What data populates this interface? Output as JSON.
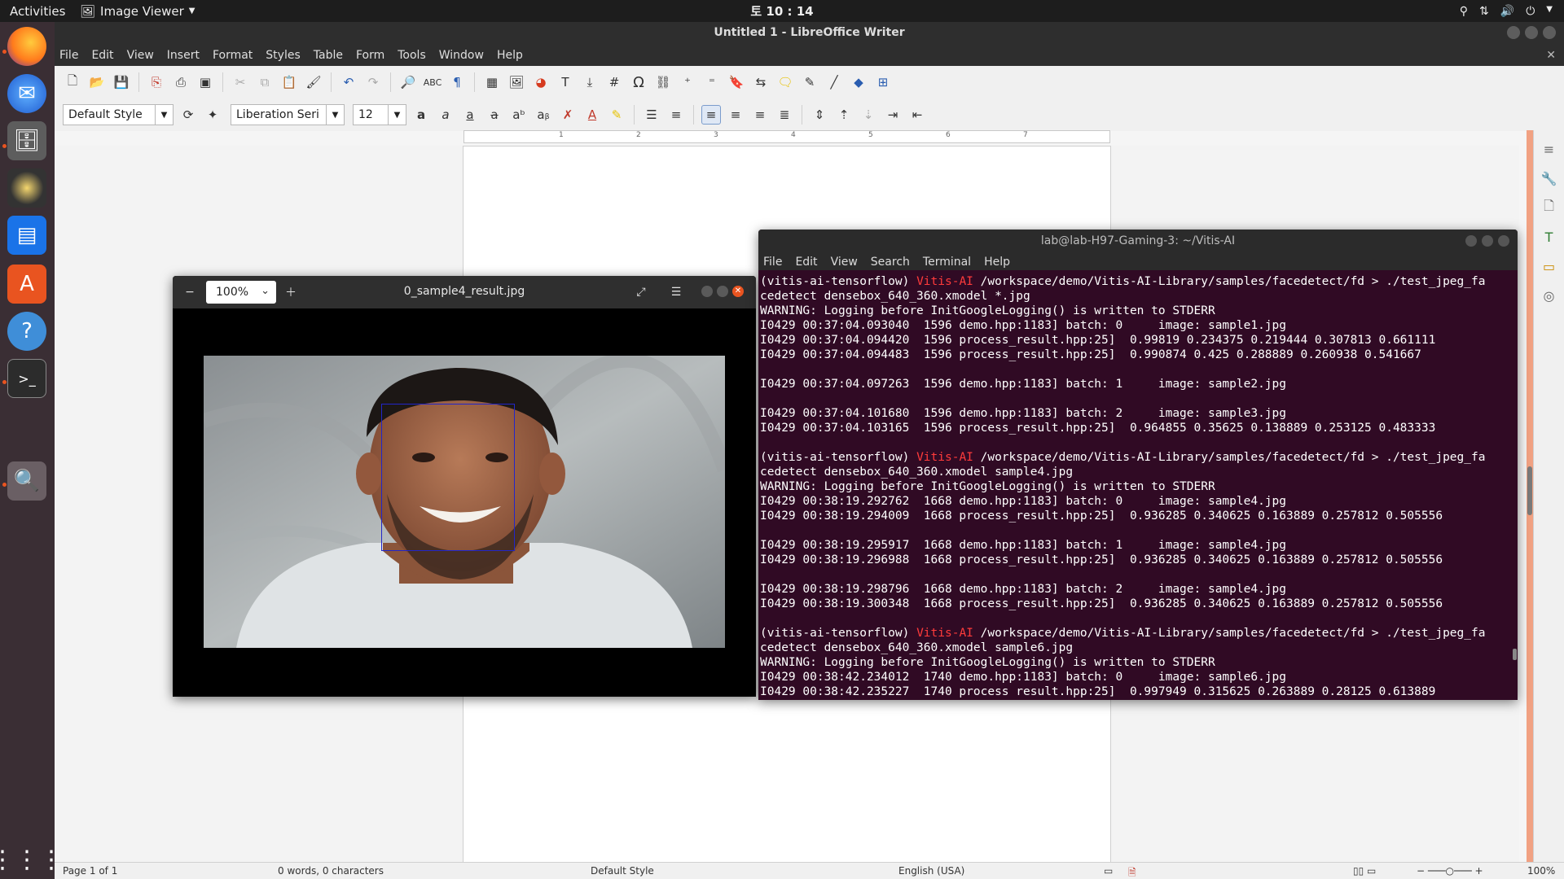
{
  "topbar": {
    "activities": "Activities",
    "app_menu": "Image Viewer",
    "clock": "토 10 : 14"
  },
  "dock": {
    "items": [
      "firefox-icon",
      "thunderbird-icon",
      "files-icon",
      "rhythmbox-icon",
      "writer-icon",
      "software-icon",
      "help-icon",
      "terminal-icon",
      "image-viewer-icon"
    ]
  },
  "writer": {
    "title": "Untitled 1 - LibreOffice Writer",
    "menu": [
      "File",
      "Edit",
      "View",
      "Insert",
      "Format",
      "Styles",
      "Table",
      "Form",
      "Tools",
      "Window",
      "Help"
    ],
    "paragraph_style": "Default Style",
    "font_name": "Liberation Seri",
    "font_size": "12",
    "ruler_numbers": [
      "1",
      "2",
      "3",
      "4",
      "5",
      "6",
      "7"
    ],
    "status": {
      "page": "Page 1 of 1",
      "words": "0 words, 0 characters",
      "style": "Default Style",
      "language": "English (USA)",
      "zoom": "100%"
    }
  },
  "viewer": {
    "filename": "0_sample4_result.jpg",
    "zoom": "100%"
  },
  "terminal": {
    "title": "lab@lab-H97-Gaming-3: ~/Vitis-AI",
    "menu": [
      "File",
      "Edit",
      "View",
      "Search",
      "Terminal",
      "Help"
    ],
    "lines": [
      {
        "venv": "(vitis-ai-tensorflow) ",
        "host": "Vitis-AI",
        "text": " /workspace/demo/Vitis-AI-Library/samples/facedetect/fd > ./test_jpeg_fa"
      },
      {
        "text": "cedetect densebox_640_360.xmodel *.jpg"
      },
      {
        "text": "WARNING: Logging before InitGoogleLogging() is written to STDERR"
      },
      {
        "text": "I0429 00:37:04.093040  1596 demo.hpp:1183] batch: 0     image: sample1.jpg"
      },
      {
        "text": "I0429 00:37:04.094420  1596 process_result.hpp:25]  0.99819 0.234375 0.219444 0.307813 0.661111"
      },
      {
        "text": "I0429 00:37:04.094483  1596 process_result.hpp:25]  0.990874 0.425 0.288889 0.260938 0.541667"
      },
      {
        "text": ""
      },
      {
        "text": "I0429 00:37:04.097263  1596 demo.hpp:1183] batch: 1     image: sample2.jpg"
      },
      {
        "text": ""
      },
      {
        "text": "I0429 00:37:04.101680  1596 demo.hpp:1183] batch: 2     image: sample3.jpg"
      },
      {
        "text": "I0429 00:37:04.103165  1596 process_result.hpp:25]  0.964855 0.35625 0.138889 0.253125 0.483333"
      },
      {
        "text": ""
      },
      {
        "venv": "(vitis-ai-tensorflow) ",
        "host": "Vitis-AI",
        "text": " /workspace/demo/Vitis-AI-Library/samples/facedetect/fd > ./test_jpeg_fa"
      },
      {
        "text": "cedetect densebox_640_360.xmodel sample4.jpg"
      },
      {
        "text": "WARNING: Logging before InitGoogleLogging() is written to STDERR"
      },
      {
        "text": "I0429 00:38:19.292762  1668 demo.hpp:1183] batch: 0     image: sample4.jpg"
      },
      {
        "text": "I0429 00:38:19.294009  1668 process_result.hpp:25]  0.936285 0.340625 0.163889 0.257812 0.505556"
      },
      {
        "text": ""
      },
      {
        "text": "I0429 00:38:19.295917  1668 demo.hpp:1183] batch: 1     image: sample4.jpg"
      },
      {
        "text": "I0429 00:38:19.296988  1668 process_result.hpp:25]  0.936285 0.340625 0.163889 0.257812 0.505556"
      },
      {
        "text": ""
      },
      {
        "text": "I0429 00:38:19.298796  1668 demo.hpp:1183] batch: 2     image: sample4.jpg"
      },
      {
        "text": "I0429 00:38:19.300348  1668 process_result.hpp:25]  0.936285 0.340625 0.163889 0.257812 0.505556"
      },
      {
        "text": ""
      },
      {
        "venv": "(vitis-ai-tensorflow) ",
        "host": "Vitis-AI",
        "text": " /workspace/demo/Vitis-AI-Library/samples/facedetect/fd > ./test_jpeg_fa"
      },
      {
        "text": "cedetect densebox_640_360.xmodel sample6.jpg"
      },
      {
        "text": "WARNING: Logging before InitGoogleLogging() is written to STDERR"
      },
      {
        "text": "I0429 00:38:42.234012  1740 demo.hpp:1183] batch: 0     image: sample6.jpg"
      },
      {
        "text": "I0429 00:38:42.235227  1740 process_result.hpp:25]  0.997949 0.315625 0.263889 0.28125 0.613889"
      }
    ]
  },
  "colors": {
    "terminal_bg": "#300a24",
    "prompt_host": "#ff3b3b",
    "accent": "#e95420",
    "face_box": "#2226c9"
  }
}
